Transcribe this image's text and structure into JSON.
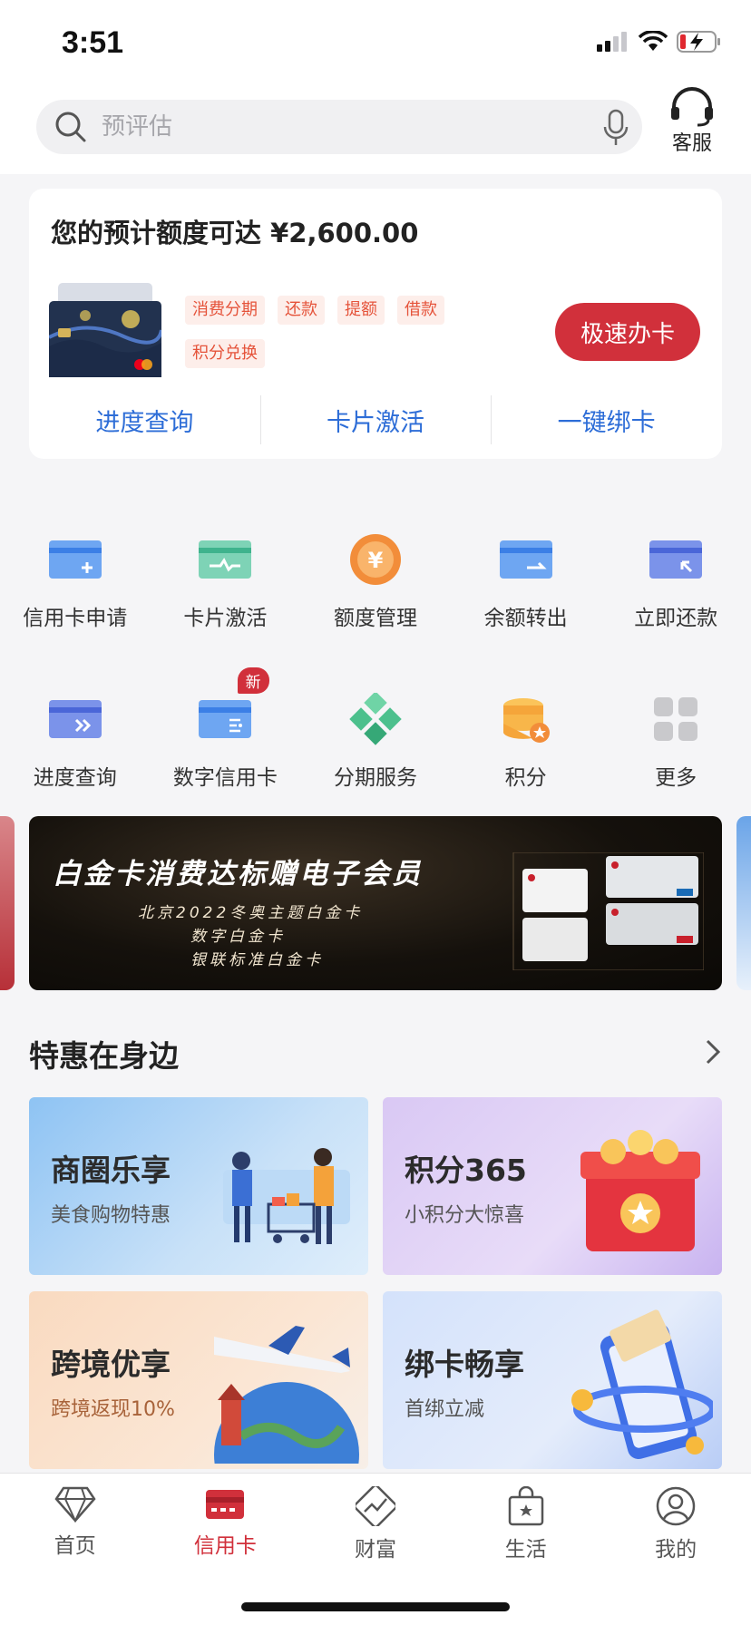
{
  "status_bar": {
    "time": "3:51"
  },
  "search": {
    "placeholder": "预评估"
  },
  "service": {
    "label": "客服"
  },
  "quota_card": {
    "title": "您的预计额度可达 ¥2,600.00",
    "tags": [
      "消费分期",
      "还款",
      "提额",
      "借款",
      "积分兑换"
    ],
    "apply_button": "极速办卡",
    "links": [
      "进度查询",
      "卡片激活",
      "一键绑卡"
    ]
  },
  "grid": {
    "row1": [
      {
        "label": "信用卡申请",
        "icon": "card-add-icon"
      },
      {
        "label": "卡片激活",
        "icon": "card-activate-icon"
      },
      {
        "label": "额度管理",
        "icon": "yuan-coin-icon"
      },
      {
        "label": "余额转出",
        "icon": "card-transfer-icon"
      },
      {
        "label": "立即还款",
        "icon": "card-repay-icon"
      }
    ],
    "row2": [
      {
        "label": "进度查询",
        "icon": "card-progress-icon"
      },
      {
        "label": "数字信用卡",
        "icon": "digital-card-icon",
        "badge": "新"
      },
      {
        "label": "分期服务",
        "icon": "diamond-grid-icon"
      },
      {
        "label": "积分",
        "icon": "coin-stack-icon"
      },
      {
        "label": "更多",
        "icon": "more-grid-icon"
      }
    ]
  },
  "banner": {
    "title": "白金卡消费达标赠电子会员",
    "lines": [
      "北京2022冬奥主题白金卡",
      "数字白金卡",
      "银联标准白金卡"
    ]
  },
  "deals": {
    "title": "特惠在身边",
    "items": [
      {
        "title": "商圈乐享",
        "subtitle": "美食购物特惠"
      },
      {
        "title": "积分365",
        "subtitle": "小积分大惊喜"
      },
      {
        "title": "跨境优享",
        "subtitle": "跨境返现10%"
      },
      {
        "title": "绑卡畅享",
        "subtitle": "首绑立减"
      }
    ]
  },
  "tabbar": {
    "tabs": [
      {
        "label": "首页",
        "icon": "diamond-icon"
      },
      {
        "label": "信用卡",
        "icon": "credit-card-icon",
        "active": true
      },
      {
        "label": "财富",
        "icon": "wealth-chart-icon"
      },
      {
        "label": "生活",
        "icon": "shopping-bag-icon"
      },
      {
        "label": "我的",
        "icon": "user-icon"
      }
    ]
  },
  "colors": {
    "accent": "#d1303b",
    "link": "#2d6dd7",
    "tag_text": "#e5533a",
    "tag_bg": "#fdeeea"
  }
}
